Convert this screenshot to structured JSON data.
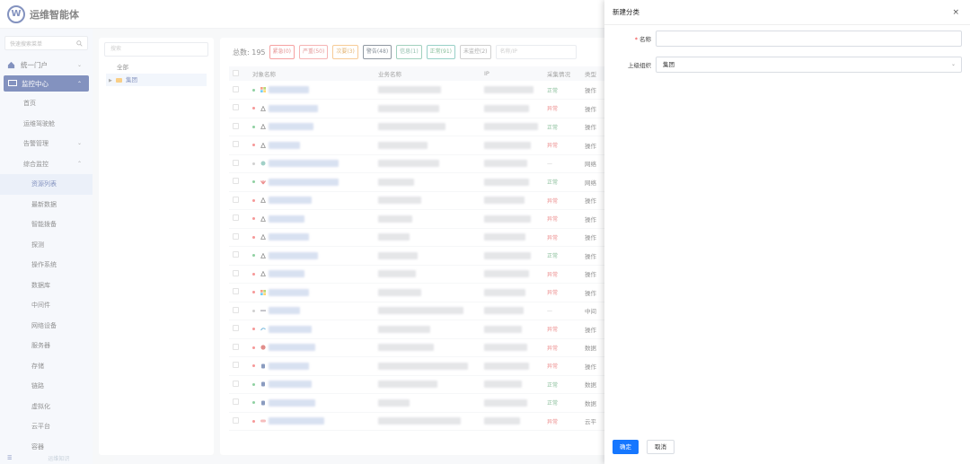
{
  "app": {
    "title": "运维智能体",
    "logo_letter": "W"
  },
  "sidebar": {
    "search_placeholder": "快速搜索菜单",
    "groups": [
      {
        "label": "统一门户",
        "icon": "home-icon"
      },
      {
        "label": "监控中心",
        "icon": "monitor-icon"
      }
    ],
    "items": [
      "首页",
      "运维驾驶舱",
      "告警管理",
      "综合监控"
    ],
    "sub_items": [
      "资源列表",
      "最新数据",
      "智能拨备",
      "探测",
      "操作系统",
      "数据库",
      "中间件",
      "网络设备",
      "服务器",
      "存储",
      "链路",
      "虚拟化",
      "云平台",
      "容器"
    ],
    "footer": "运维知识"
  },
  "tree": {
    "search_placeholder": "搜索",
    "nodes": [
      "全部",
      "集团"
    ]
  },
  "filters": {
    "total_label": "总数: 195",
    "tags": [
      "紧急(0)",
      "严重(50)",
      "次要(3)",
      "警告(48)",
      "信息(1)",
      "正常(91)",
      "未监控(2)"
    ],
    "search_placeholder": "名称/IP"
  },
  "table": {
    "headers": [
      "对象名称",
      "业务名称",
      "IP",
      "采集情况",
      "类型"
    ],
    "rows": [
      {
        "dot": "g",
        "os": "windows",
        "status": "正常",
        "status_class": "ok",
        "type": "操作"
      },
      {
        "dot": "r",
        "os": "linux",
        "status": "异常",
        "status_class": "bad",
        "type": "操作"
      },
      {
        "dot": "g",
        "os": "linux",
        "status": "正常",
        "status_class": "ok",
        "type": "操作"
      },
      {
        "dot": "r",
        "os": "linux",
        "status": "异常",
        "status_class": "bad",
        "type": "操作"
      },
      {
        "dot": "gr",
        "os": "network",
        "status": "—",
        "status_class": "na",
        "type": "网络"
      },
      {
        "dot": "g",
        "os": "huawei",
        "status": "正常",
        "status_class": "ok",
        "type": "网络"
      },
      {
        "dot": "r",
        "os": "linux",
        "status": "异常",
        "status_class": "bad",
        "type": "操作"
      },
      {
        "dot": "r",
        "os": "linux",
        "status": "异常",
        "status_class": "bad",
        "type": "操作"
      },
      {
        "dot": "r",
        "os": "linux",
        "status": "异常",
        "status_class": "bad",
        "type": "操作"
      },
      {
        "dot": "g",
        "os": "linux",
        "status": "正常",
        "status_class": "ok",
        "type": "操作"
      },
      {
        "dot": "r",
        "os": "linux",
        "status": "异常",
        "status_class": "bad",
        "type": "操作"
      },
      {
        "dot": "r",
        "os": "windows",
        "status": "异常",
        "status_class": "bad",
        "type": "操作"
      },
      {
        "dot": "gr",
        "os": "middleware",
        "status": "—",
        "status_class": "na",
        "type": "中间"
      },
      {
        "dot": "r",
        "os": "mysql",
        "status": "异常",
        "status_class": "bad",
        "type": "操作"
      },
      {
        "dot": "r",
        "os": "redis",
        "status": "异常",
        "status_class": "bad",
        "type": "数据"
      },
      {
        "dot": "r",
        "os": "db",
        "status": "异常",
        "status_class": "bad",
        "type": "操作"
      },
      {
        "dot": "g",
        "os": "db",
        "status": "正常",
        "status_class": "ok",
        "type": "数据"
      },
      {
        "dot": "g",
        "os": "db",
        "status": "正常",
        "status_class": "ok",
        "type": "数据"
      },
      {
        "dot": "r",
        "os": "cloud",
        "status": "异常",
        "status_class": "bad",
        "type": "云平"
      }
    ]
  },
  "drawer": {
    "title": "新建分类",
    "name_label": "名称",
    "name_value": "",
    "parent_label": "上级组织",
    "parent_value": "集团",
    "confirm_label": "确定",
    "cancel_label": "取消"
  },
  "colors": {
    "brand": "#1e3a8a",
    "primary": "#1677ff",
    "danger": "#d33",
    "success": "#2a8a4a"
  }
}
